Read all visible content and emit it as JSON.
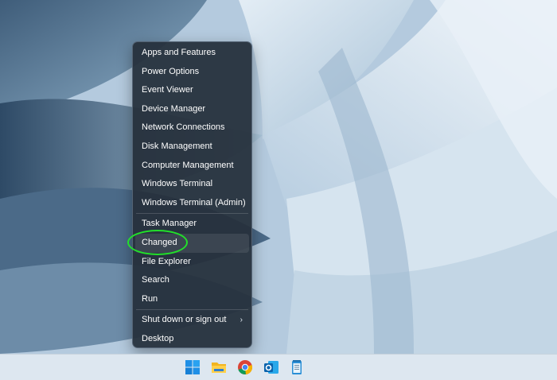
{
  "menu": {
    "items": [
      {
        "label": "Apps and Features"
      },
      {
        "label": "Power Options"
      },
      {
        "label": "Event Viewer"
      },
      {
        "label": "Device Manager"
      },
      {
        "label": "Network Connections"
      },
      {
        "label": "Disk Management"
      },
      {
        "label": "Computer Management"
      },
      {
        "label": "Windows Terminal"
      },
      {
        "label": "Windows Terminal (Admin)"
      },
      {
        "label": "Task Manager"
      },
      {
        "label": "Changed"
      },
      {
        "label": "File Explorer"
      },
      {
        "label": "Search"
      },
      {
        "label": "Run"
      },
      {
        "label": "Shut down or sign out"
      },
      {
        "label": "Desktop"
      }
    ],
    "submenu_arrow": "›"
  },
  "taskbar": {
    "icons": [
      "windows-start-icon",
      "file-explorer-icon",
      "chrome-icon",
      "outlook-icon",
      "notepad-icon"
    ]
  },
  "colors": {
    "menu_bg": "#26303c",
    "highlight_circle": "#22e02a",
    "taskbar_bg": "#dde7f0"
  }
}
